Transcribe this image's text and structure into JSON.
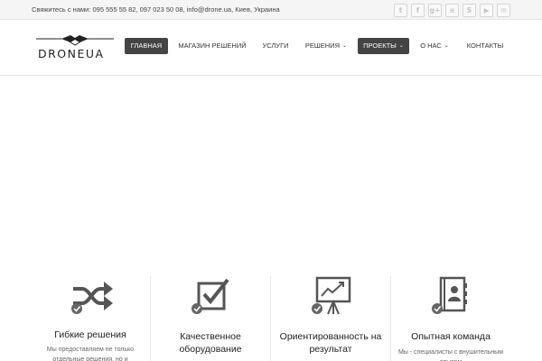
{
  "topbar": {
    "contact_text": "Свяжитесь с нами: 095 555 55 82, 097 023 50 08, info@drone.ua, Киев, Украина",
    "socials": [
      {
        "name": "twitter-icon",
        "glyph": "t"
      },
      {
        "name": "facebook-icon",
        "glyph": "f"
      },
      {
        "name": "google-plus-icon",
        "glyph": "g+"
      },
      {
        "name": "rss-icon",
        "glyph": "≋"
      },
      {
        "name": "skype-icon",
        "glyph": "S"
      },
      {
        "name": "youtube-icon",
        "glyph": "▶"
      },
      {
        "name": "email-icon",
        "glyph": "✉"
      }
    ]
  },
  "header": {
    "logo_text": "DRONEUA"
  },
  "nav": {
    "items": [
      {
        "label": "ГЛАВНАЯ",
        "active": true,
        "dropdown": false
      },
      {
        "label": "МАГАЗИН РЕШЕНИЙ",
        "active": false,
        "dropdown": false
      },
      {
        "label": "УСЛУГИ",
        "active": false,
        "dropdown": false
      },
      {
        "label": "РЕШЕНИЯ",
        "active": false,
        "dropdown": true
      },
      {
        "label": "ПРОЕКТЫ",
        "active": true,
        "dropdown": true
      },
      {
        "label": "О НАС",
        "active": false,
        "dropdown": true
      },
      {
        "label": "КОНТАКТЫ",
        "active": false,
        "dropdown": false
      }
    ]
  },
  "features": [
    {
      "icon": "shuffle-icon",
      "title": "Гибкие решения",
      "desc": "Мы предоставляем не только отдельные решения, но и"
    },
    {
      "icon": "checkbox-icon",
      "title": "Качественное оборудование",
      "desc": ""
    },
    {
      "icon": "presentation-chart-icon",
      "title": "Ориентированность на результат",
      "desc": ""
    },
    {
      "icon": "contact-book-icon",
      "title": "Опытная команда",
      "desc": "Мы - специалисты с внушительным опытом"
    }
  ],
  "colors": {
    "nav_active_bg": "#444444",
    "icon_gray": "#555555",
    "badge_gray": "#666666"
  }
}
